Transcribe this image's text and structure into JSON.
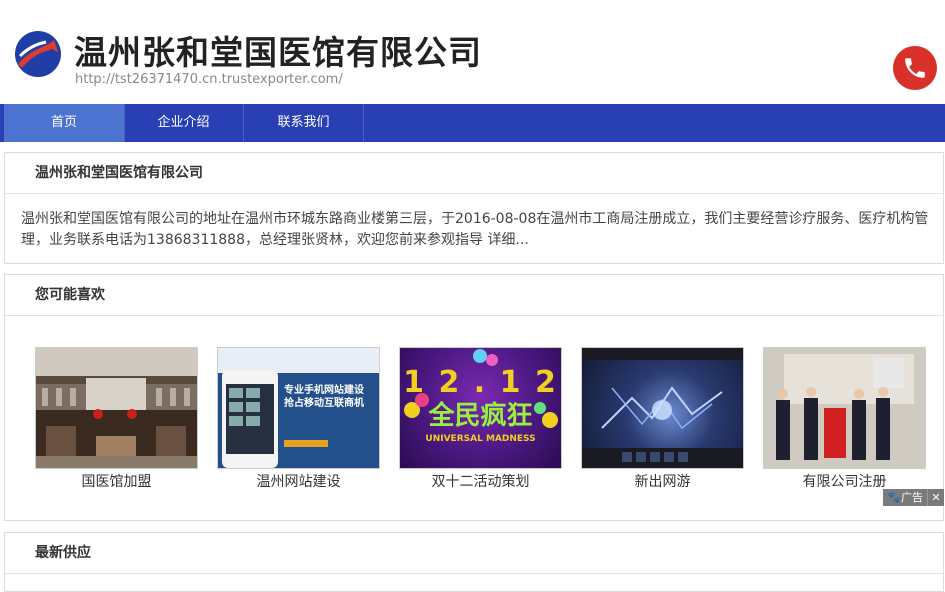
{
  "header": {
    "title": "温州张和堂国医馆有限公司",
    "url": "http://tst26371470.cn.trustexporter.com/",
    "logo_icon": "swoosh-arrow-logo",
    "phone_icon": "phone-icon"
  },
  "nav": {
    "items": [
      {
        "label": "首页",
        "active": true
      },
      {
        "label": "企业介绍",
        "active": false
      },
      {
        "label": "联系我们",
        "active": false
      }
    ]
  },
  "intro": {
    "heading": "温州张和堂国医馆有限公司",
    "text": "温州张和堂国医馆有限公司的地址在温州市环城东路商业楼第三层，于2016-08-08在温州市工商局注册成立，我们主要经营诊疗服务、医疗机构管理，业务联系电话为13868311888，总经理张贤林，欢迎您前来参观指导",
    "more": "详细..."
  },
  "recommend": {
    "heading": "您可能喜欢",
    "products": [
      {
        "caption": "国医馆加盟"
      },
      {
        "caption": "温州网站建设",
        "image_text": [
          "专业手机网站建设",
          "抢占移动互联商机"
        ]
      },
      {
        "caption": "双十二活动策划",
        "image_text": [
          "1 2 . 1 2",
          "全民疯狂",
          "UNIVERSAL MADNESS"
        ]
      },
      {
        "caption": "新出网游"
      },
      {
        "caption": "有限公司注册"
      }
    ]
  },
  "ad": {
    "label": "广告",
    "close": "✕"
  },
  "supply": {
    "heading": "最新供应"
  },
  "colors": {
    "nav": "#2840b4",
    "nav_active": "#4d73d0",
    "phone": "#d9312a"
  }
}
